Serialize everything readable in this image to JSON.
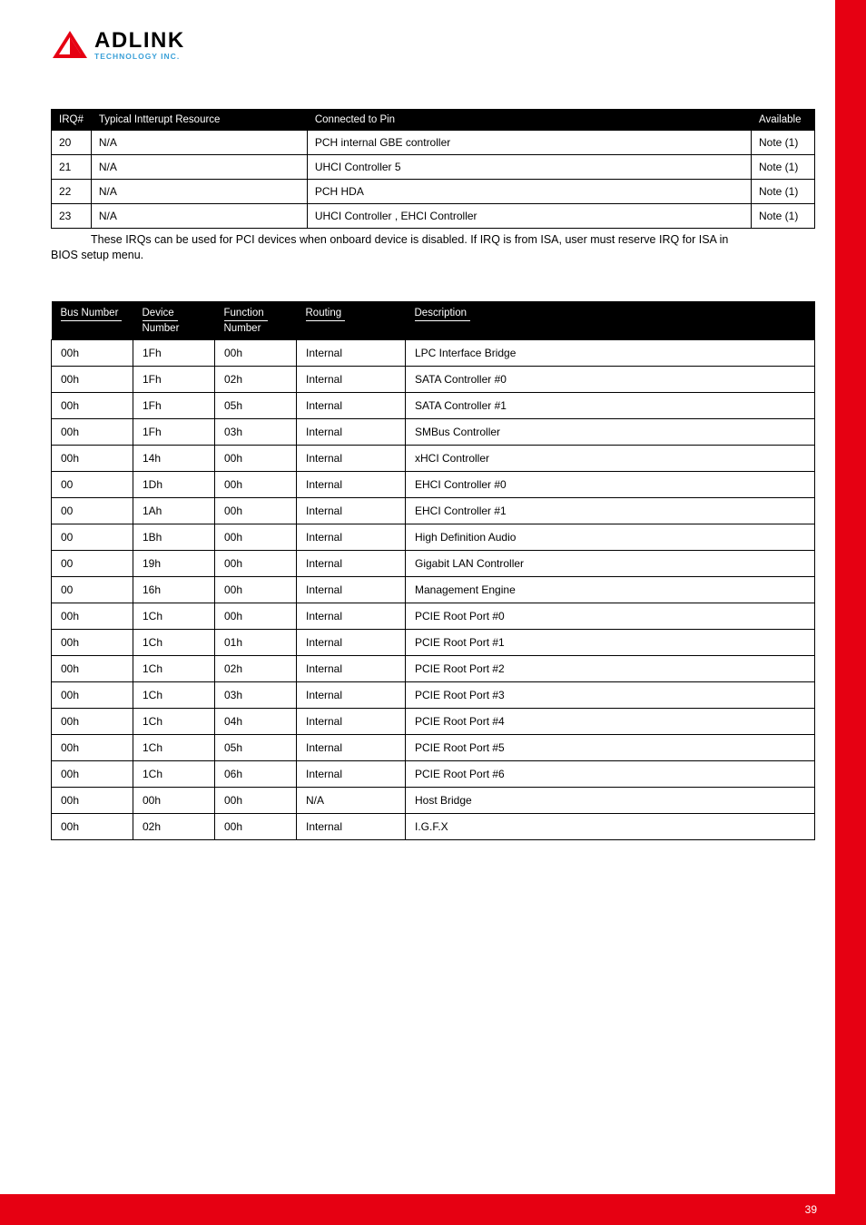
{
  "logo": {
    "main": "ADLINK",
    "sub": "TECHNOLOGY INC."
  },
  "table1": {
    "headers": {
      "irq": "IRQ#",
      "resource": "Typical Intterupt Resource",
      "pin": "Connected to Pin",
      "avail": "Available"
    },
    "rows": [
      {
        "irq": "20",
        "resource": "N/A",
        "pin": "PCH internal GBE controller",
        "avail": "Note (1)"
      },
      {
        "irq": "21",
        "resource": "N/A",
        "pin": "UHCI Controller 5",
        "avail": "Note (1)"
      },
      {
        "irq": "22",
        "resource": "N/A",
        "pin": "PCH HDA",
        "avail": "Note (1)"
      },
      {
        "irq": "23",
        "resource": "N/A",
        "pin": "UHCI Controller , EHCI Controller",
        "avail": "Note (1)"
      }
    ]
  },
  "note_line1": "These IRQs can be used for PCI devices when onboard device is disabled. If IRQ is from ISA, user must reserve IRQ for ISA in",
  "note_line2": "BIOS setup menu.",
  "table2": {
    "headers": {
      "bus": "Bus Number",
      "dev1": "Device",
      "dev2": "Number",
      "fn1": "Function",
      "fn2": "Number",
      "routing": "Routing",
      "desc": "Description"
    },
    "rows": [
      {
        "bus": "00h",
        "dev": "1Fh",
        "fn": "00h",
        "routing": "Internal",
        "desc": "LPC Interface Bridge"
      },
      {
        "bus": "00h",
        "dev": "1Fh",
        "fn": "02h",
        "routing": "Internal",
        "desc": "SATA Controller #0"
      },
      {
        "bus": "00h",
        "dev": "1Fh",
        "fn": "05h",
        "routing": "Internal",
        "desc": "SATA Controller #1"
      },
      {
        "bus": "00h",
        "dev": "1Fh",
        "fn": "03h",
        "routing": "Internal",
        "desc": "SMBus Controller"
      },
      {
        "bus": "00h",
        "dev": "14h",
        "fn": "00h",
        "routing": "Internal",
        "desc": "xHCI Controller"
      },
      {
        "bus": "00",
        "dev": "1Dh",
        "fn": "00h",
        "routing": "Internal",
        "desc": "EHCI Controller #0"
      },
      {
        "bus": "00",
        "dev": "1Ah",
        "fn": "00h",
        "routing": "Internal",
        "desc": "EHCI Controller #1"
      },
      {
        "bus": "00",
        "dev": "1Bh",
        "fn": "00h",
        "routing": "Internal",
        "desc": "High Definition Audio"
      },
      {
        "bus": "00",
        "dev": "19h",
        "fn": "00h",
        "routing": "Internal",
        "desc": "Gigabit LAN Controller"
      },
      {
        "bus": "00",
        "dev": "16h",
        "fn": "00h",
        "routing": "Internal",
        "desc": "Management Engine"
      },
      {
        "bus": "00h",
        "dev": "1Ch",
        "fn": "00h",
        "routing": "Internal",
        "desc": "PCIE Root Port #0"
      },
      {
        "bus": "00h",
        "dev": "1Ch",
        "fn": "01h",
        "routing": "Internal",
        "desc": "PCIE Root Port #1"
      },
      {
        "bus": "00h",
        "dev": "1Ch",
        "fn": "02h",
        "routing": "Internal",
        "desc": "PCIE Root Port #2"
      },
      {
        "bus": "00h",
        "dev": "1Ch",
        "fn": "03h",
        "routing": "Internal",
        "desc": "PCIE Root Port #3"
      },
      {
        "bus": "00h",
        "dev": "1Ch",
        "fn": "04h",
        "routing": "Internal",
        "desc": "PCIE Root Port #4"
      },
      {
        "bus": "00h",
        "dev": "1Ch",
        "fn": "05h",
        "routing": "Internal",
        "desc": "PCIE Root Port #5"
      },
      {
        "bus": "00h",
        "dev": "1Ch",
        "fn": "06h",
        "routing": "Internal",
        "desc": "PCIE Root Port #6"
      },
      {
        "bus": "00h",
        "dev": "00h",
        "fn": "00h",
        "routing": "N/A",
        "desc": "Host Bridge"
      },
      {
        "bus": "00h",
        "dev": "02h",
        "fn": "00h",
        "routing": "Internal",
        "desc": "I.G.F.X"
      }
    ]
  },
  "page_number": "39"
}
